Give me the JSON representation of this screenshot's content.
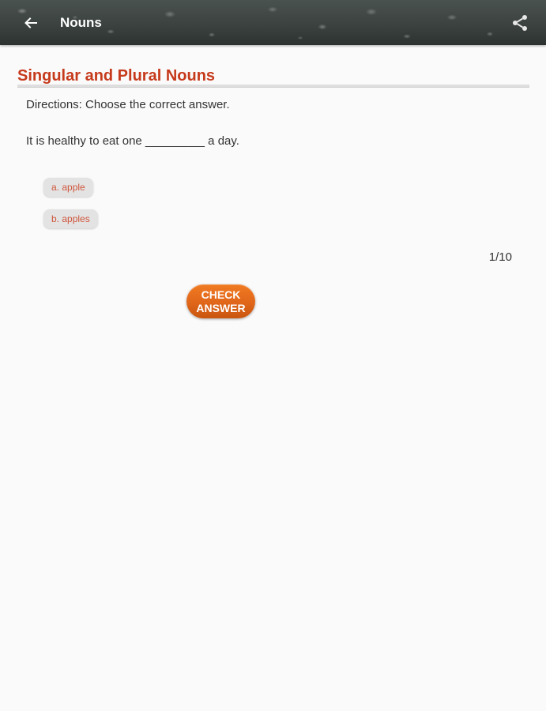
{
  "app_bar": {
    "title": "Nouns",
    "back_icon": "arrow-left-icon",
    "share_icon": "share-icon"
  },
  "lesson": {
    "title": "Singular and Plural Nouns",
    "title_color": "#c63a1c"
  },
  "quiz": {
    "directions": "Directions: Choose the correct answer.",
    "question": "It is healthy to eat one _________ a day.",
    "options": [
      {
        "label": "a. apple"
      },
      {
        "label": "b. apples"
      }
    ],
    "progress": "1/10",
    "check_label": "CHECK\nANSWER",
    "accent_color": "#e46a1c"
  }
}
